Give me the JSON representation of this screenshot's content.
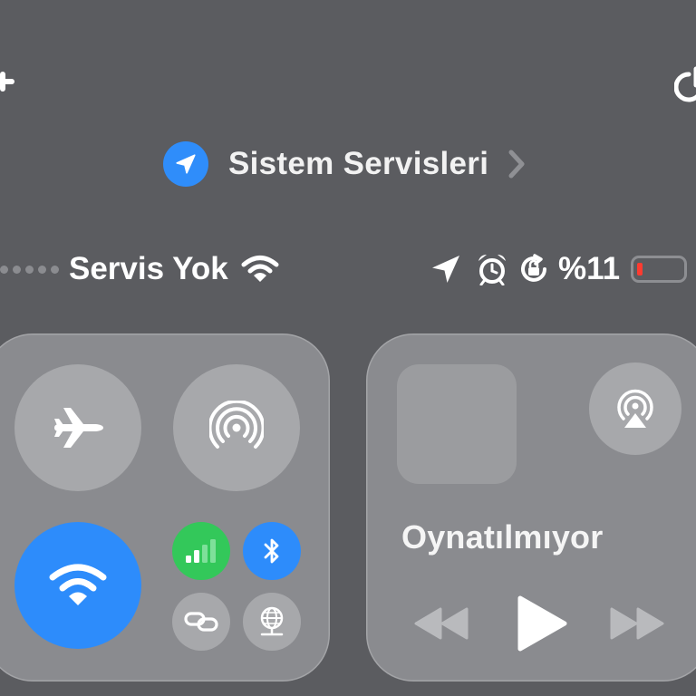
{
  "header": {
    "plus_icon": "plus-icon",
    "power_icon": "power-icon"
  },
  "system_services": {
    "label": "Sistem Servisleri",
    "icon": "location-arrow-icon",
    "icon_bg": "#2f8dfa",
    "chevron": "chevron-right-icon"
  },
  "status_bar": {
    "carrier": "Servis Yok",
    "battery_percent": "%11",
    "battery_level": 0.11,
    "battery_color": "#ff3b30",
    "icons": [
      "wifi-icon",
      "location-arrow-icon",
      "alarm-icon",
      "rotation-lock-icon"
    ]
  },
  "connectivity": {
    "airplane_mode": {
      "icon": "airplane-icon",
      "active": false
    },
    "airdrop": {
      "icon": "airdrop-icon",
      "active": false
    },
    "wifi": {
      "icon": "wifi-icon",
      "active": true,
      "color": "#2d8cfb"
    },
    "cellular_data": {
      "icon": "cellular-bars-icon",
      "active": true,
      "color": "#33c85a"
    },
    "bluetooth": {
      "icon": "bluetooth-icon",
      "active": true,
      "color": "#2d8cfb"
    },
    "personal_hotspot": {
      "icon": "link-icon",
      "active": false
    },
    "vpn": {
      "icon": "globe-network-icon",
      "active": false
    }
  },
  "media": {
    "title": "Oynatılmıyor",
    "airplay_icon": "airplay-audio-icon",
    "controls": [
      "rewind-icon",
      "play-icon",
      "fast-forward-icon"
    ]
  }
}
